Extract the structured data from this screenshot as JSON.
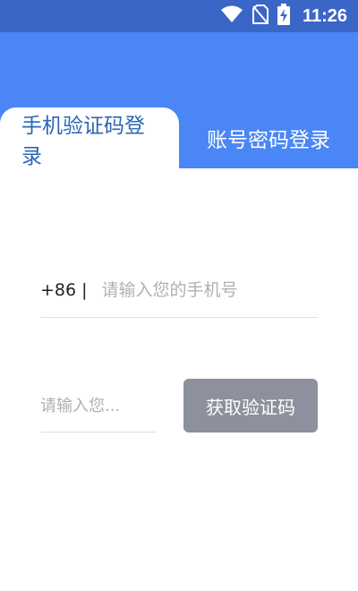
{
  "status_bar": {
    "time": "11:26",
    "icons": [
      "wifi-icon",
      "no-sim-icon",
      "battery-charging-icon"
    ]
  },
  "tabs": {
    "sms_login": "手机验证码登录",
    "account_login": "账号密码登录",
    "active": "sms_login"
  },
  "phone": {
    "prefix": "+86 |",
    "placeholder": "请输入您的手机号",
    "value": ""
  },
  "code": {
    "placeholder": "请输入您...",
    "value": ""
  },
  "get_code_button": {
    "label": "获取验证码"
  },
  "colors": {
    "status_bar": "#3a66c8",
    "header": "#4a86f5",
    "active_tab_text": "#2b66b5",
    "button_disabled": "#8c919d"
  }
}
